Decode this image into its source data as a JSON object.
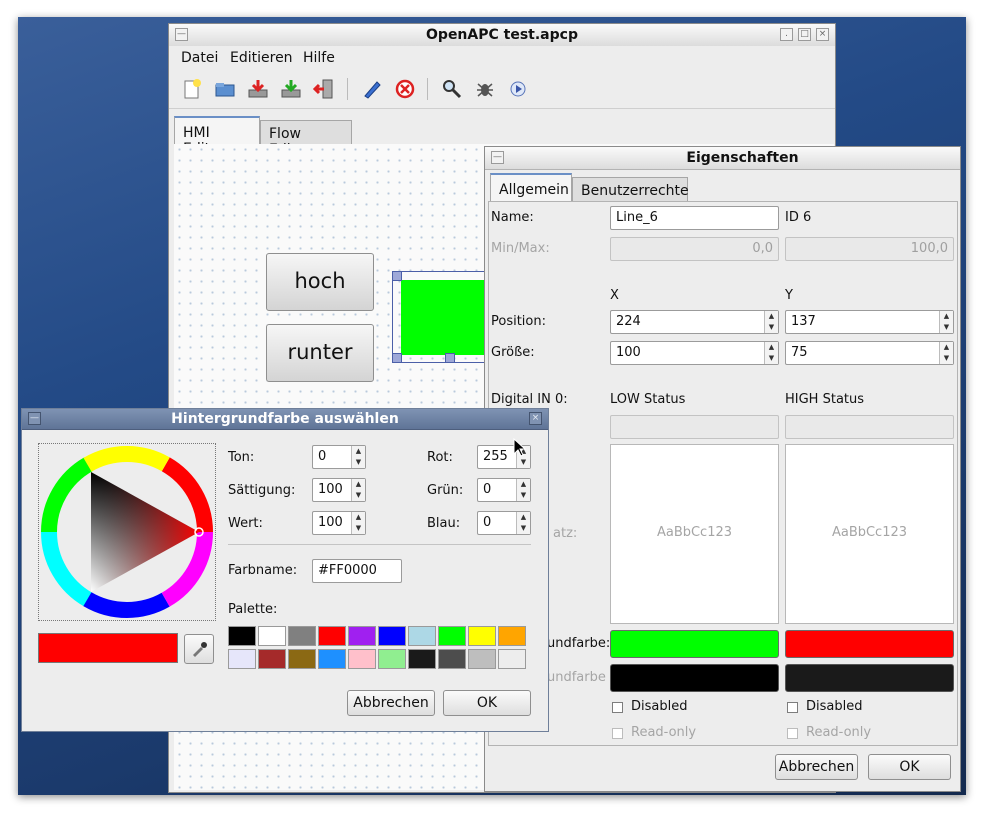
{
  "main_window": {
    "title": "OpenAPC test.apcp",
    "menu": [
      "Datei",
      "Editieren",
      "Hilfe"
    ],
    "tabs": [
      "HMI Editor",
      "Flow Editor"
    ],
    "hmi_buttons": [
      "hoch",
      "runter"
    ],
    "box_fill": "#00ff00"
  },
  "properties": {
    "title": "Eigenschaften",
    "tabs": [
      "Allgemein",
      "Benutzerrechte"
    ],
    "name_label": "Name:",
    "name_value": "Line_6",
    "id_label": "ID 6",
    "minmax_label": "Min/Max:",
    "min_value": "0,0",
    "max_value": "100,0",
    "x_header": "X",
    "y_header": "Y",
    "position_label": "Position:",
    "pos_x": "224",
    "pos_y": "137",
    "size_label": "Größe:",
    "size_x": "100",
    "size_y": "75",
    "digital_label": "Digital IN 0:",
    "low_label": "LOW Status",
    "high_label": "HIGH Status",
    "font_label_partial": "atz:",
    "font_preview": "AaBbCc123",
    "bg_label_partial": "undfarbe:",
    "fg_label_partial": "undfarbe",
    "low_bg": "#00ff00",
    "high_bg": "#ff0000",
    "low_fg": "#000000",
    "high_fg": "#1a1a1a",
    "disabled_label": "Disabled",
    "readonly_label": "Read-only",
    "cancel": "Abbrechen",
    "ok": "OK"
  },
  "color_dialog": {
    "title": "Hintergrundfarbe auswählen",
    "ton_label": "Ton:",
    "ton_value": "0",
    "sat_label": "Sättigung:",
    "sat_value": "100",
    "wert_label": "Wert:",
    "wert_value": "100",
    "rot_label": "Rot:",
    "rot_value": "255",
    "gruen_label": "Grün:",
    "gruen_value": "0",
    "blau_label": "Blau:",
    "blau_value": "0",
    "farbname_label": "Farbname:",
    "farbname_value": "#FF0000",
    "palette_label": "Palette:",
    "current_color": "#ff0000",
    "palette": [
      "#000000",
      "#ffffff",
      "#808080",
      "#ff0000",
      "#a020f0",
      "#0000ff",
      "#add8e6",
      "#00ff00",
      "#ffff00",
      "#ffa500",
      "#e6e6fa",
      "#a52a2a",
      "#8b6914",
      "#1e90ff",
      "#ffc0cb",
      "#90ee90",
      "#1a1a1a",
      "#4d4d4d",
      "#bebebe",
      "#ededed"
    ],
    "cancel": "Abbrechen",
    "ok": "OK"
  }
}
